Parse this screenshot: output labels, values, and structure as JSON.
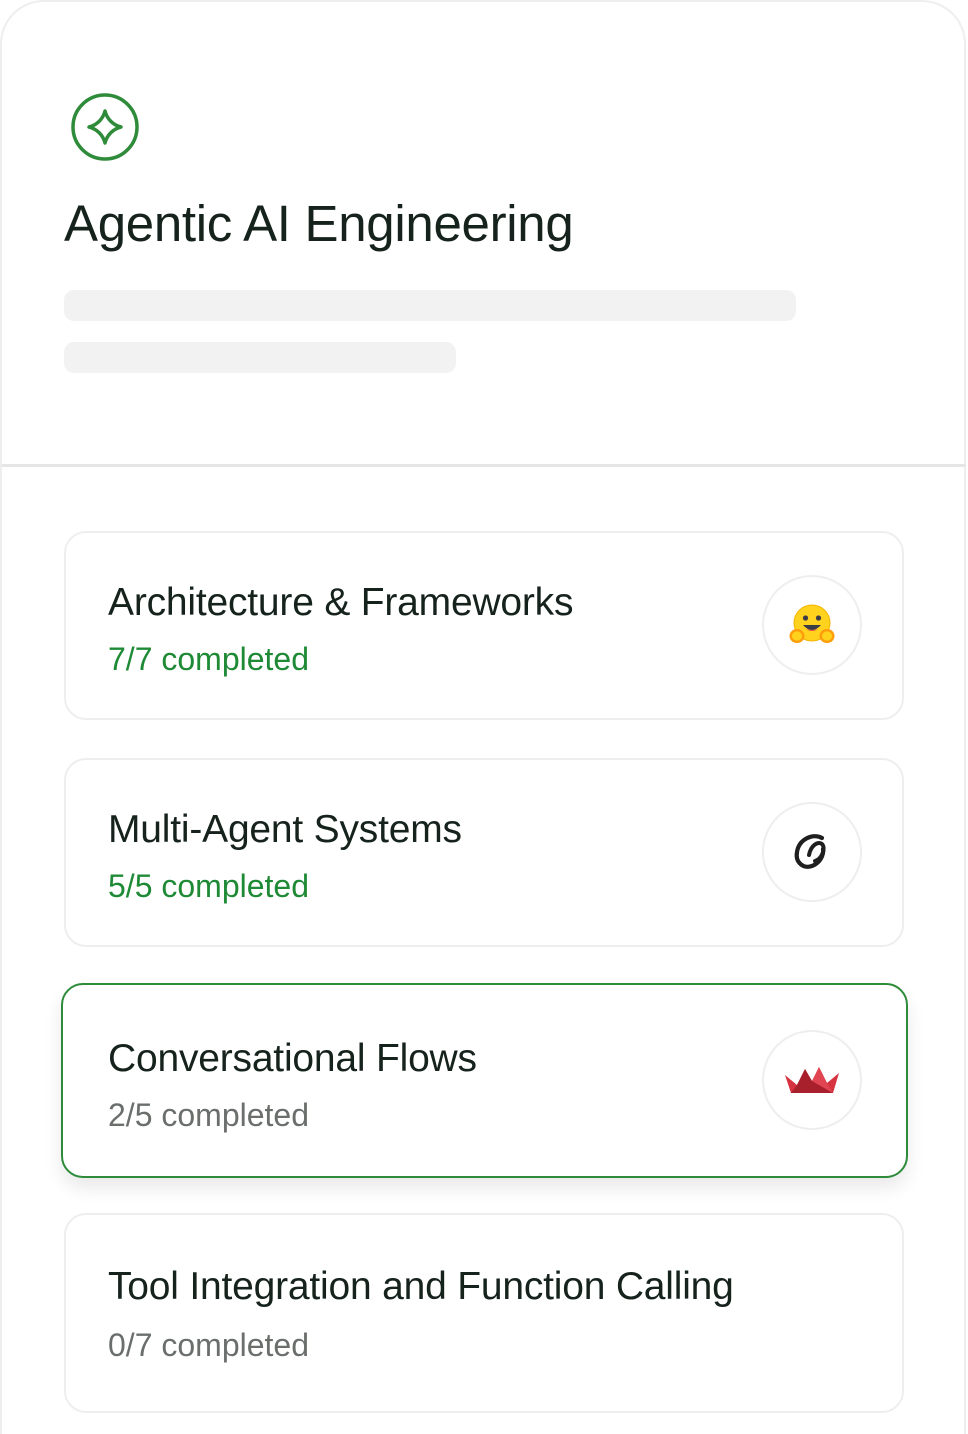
{
  "course": {
    "title": "Agentic AI Engineering",
    "brand_color": "#2e8b3a"
  },
  "modules": [
    {
      "title": "Architecture & Frameworks",
      "progress": "7/7 completed",
      "status": "completed",
      "logo_icon": "hugging-face-icon"
    },
    {
      "title": "Multi-Agent Systems",
      "progress": "5/5 completed",
      "status": "completed",
      "logo_icon": "crewai-icon"
    },
    {
      "title": "Conversational Flows",
      "progress": "2/5 completed",
      "status": "in-progress",
      "logo_icon": "crown-boat-icon"
    },
    {
      "title": "Tool Integration and Function Calling",
      "progress": "0/7 completed",
      "status": "not-started"
    }
  ],
  "colors": {
    "completed_text": "#1f8a35",
    "pending_text": "#6b6f6c",
    "active_border": "#2e8b3a"
  }
}
